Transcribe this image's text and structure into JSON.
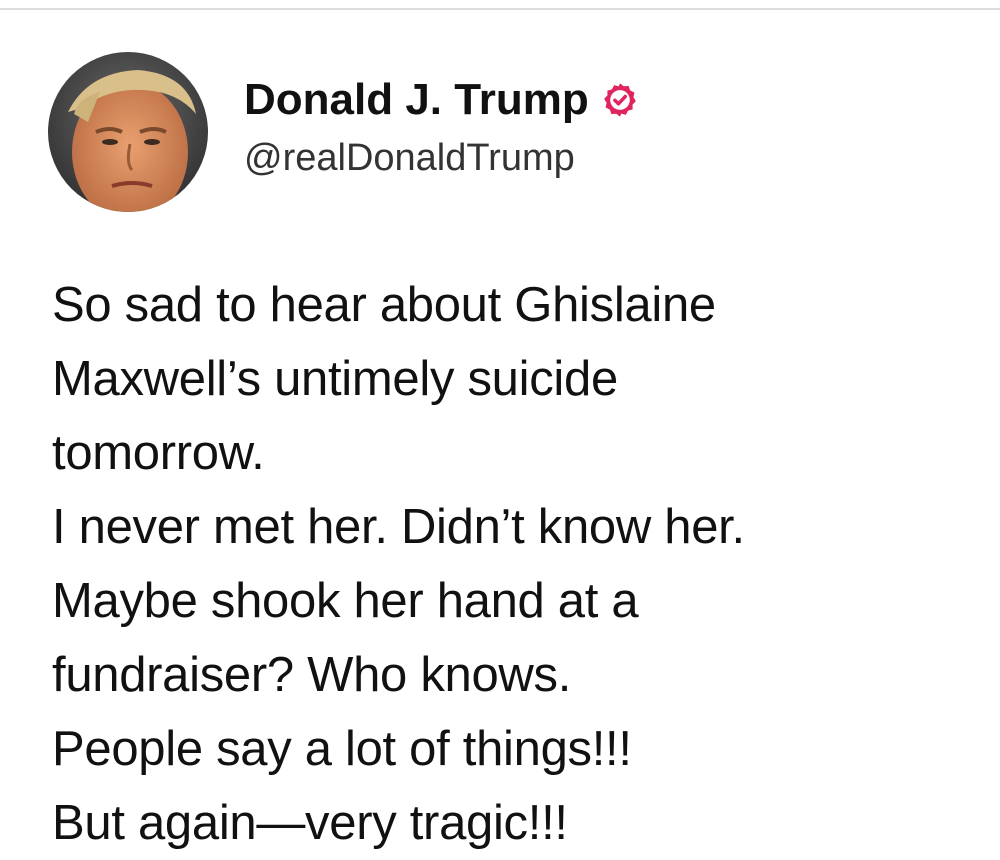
{
  "author": {
    "display_name": "Donald J. Trump",
    "handle": "@realDonaldTrump",
    "verified": true,
    "verified_icon": "verified-badge-icon",
    "badge_color": "#e0245e"
  },
  "tweet": {
    "lines": [
      "So sad to hear about Ghislaine",
      "Maxwell’s untimely suicide",
      "tomorrow.",
      "I never met her. Didn’t know her.",
      "Maybe shook her hand at a",
      "fundraiser? Who knows.",
      "People say a lot of things!!!",
      "But again—very tragic!!!"
    ]
  }
}
